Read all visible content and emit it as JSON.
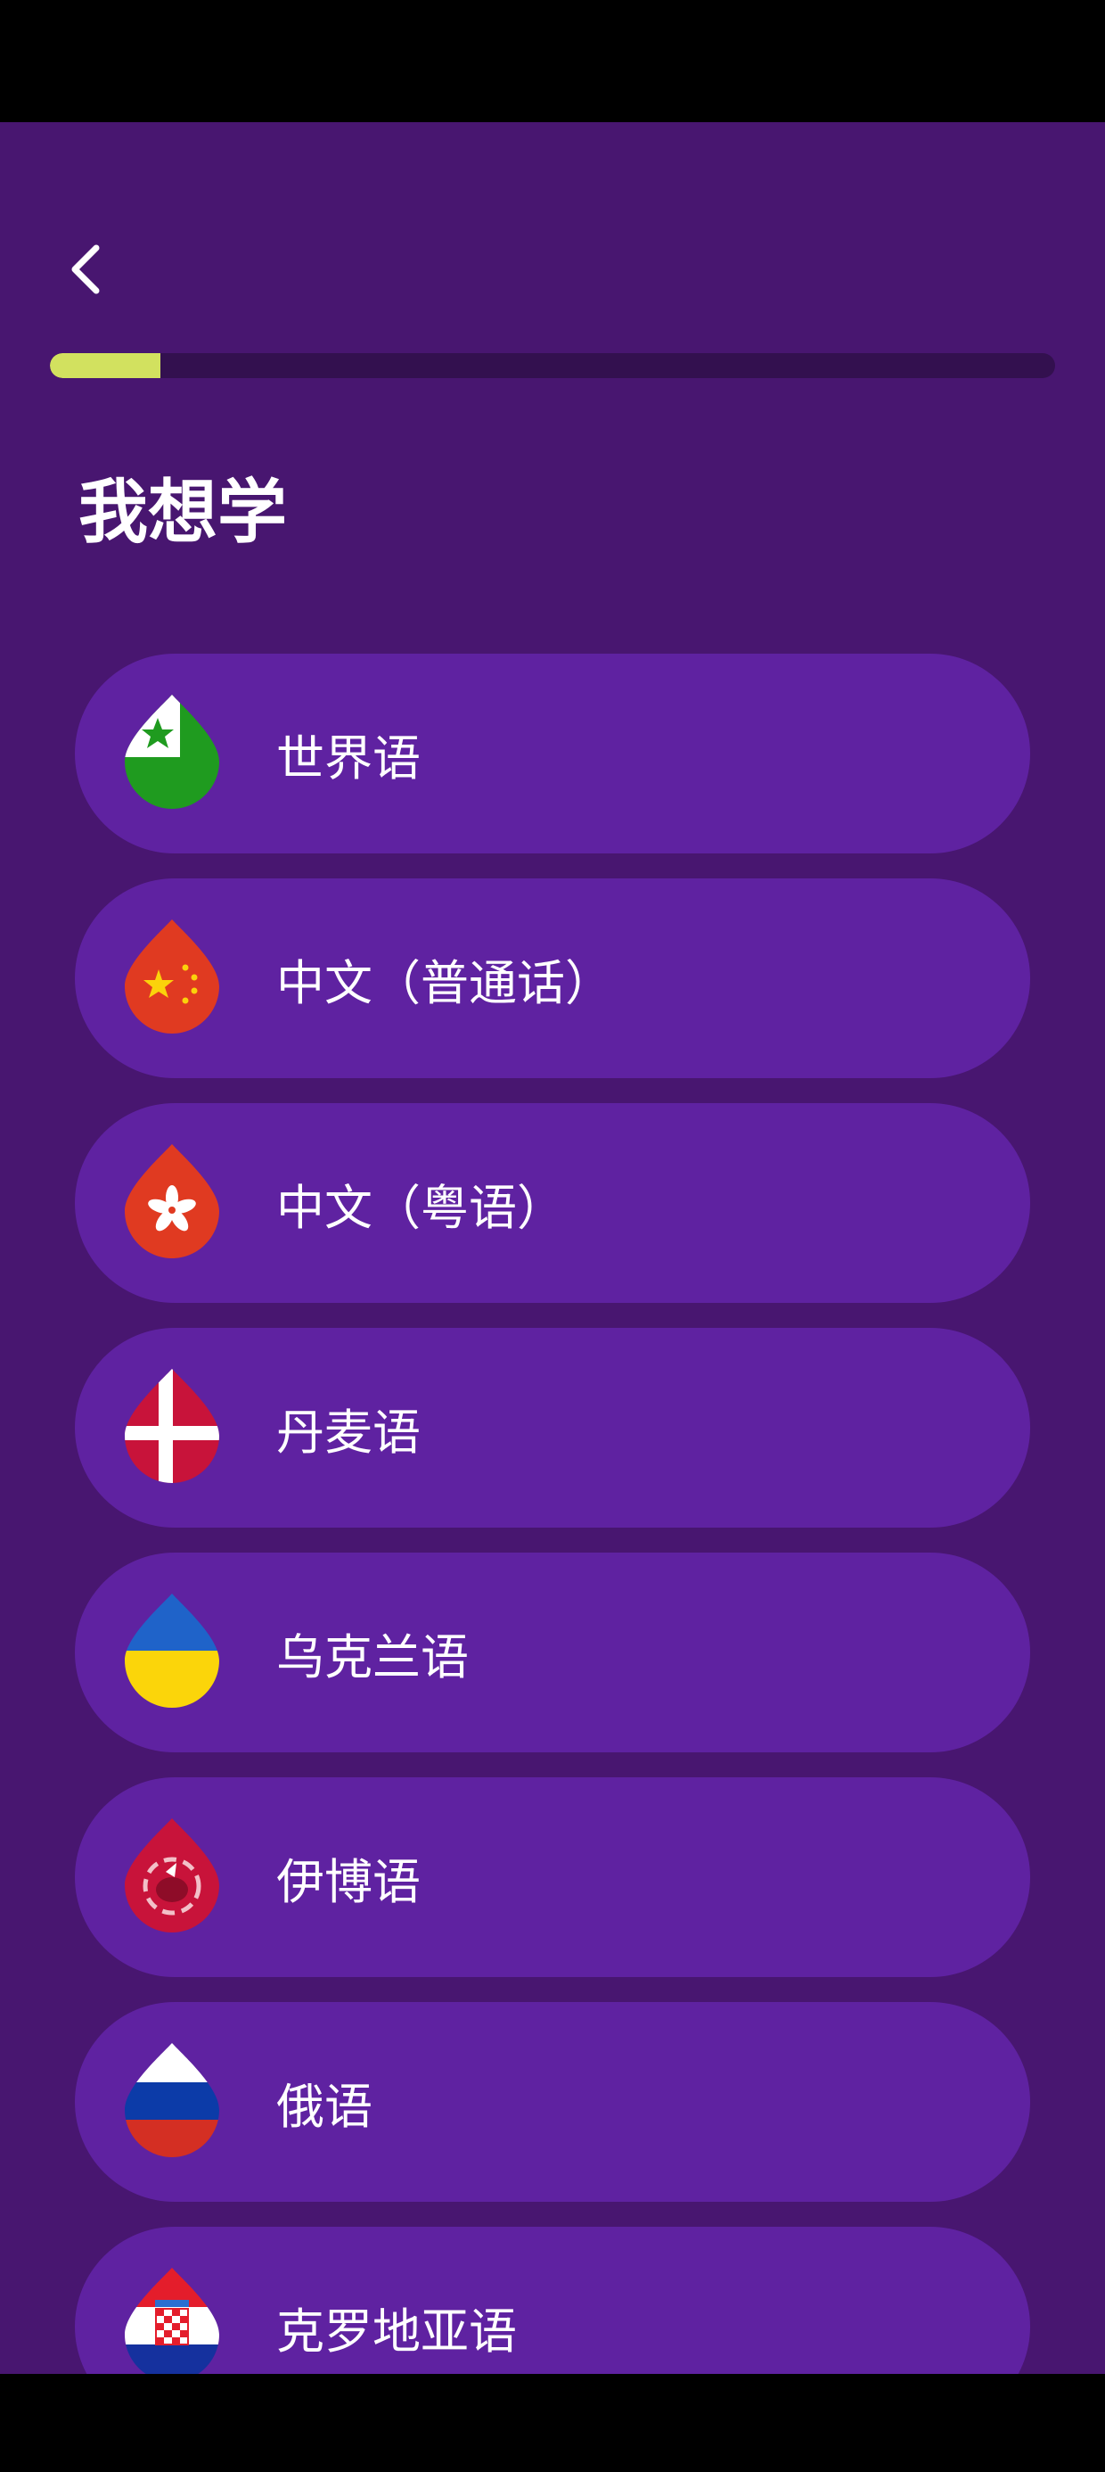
{
  "header": {
    "title": "我想学",
    "back_icon": "chevron-left-icon"
  },
  "progress": {
    "value_percent": 11,
    "fill_color": "#d2e15f",
    "track_color": "#33104f"
  },
  "theme": {
    "background": "#481670",
    "item_background": "#5f22a1",
    "text": "#ffffff"
  },
  "courses": [
    {
      "label": "世界语",
      "icon": "esperanto-flag-icon"
    },
    {
      "label": "中文（普通话）",
      "icon": "china-flag-icon"
    },
    {
      "label": "中文（粤语）",
      "icon": "hong-kong-flag-icon"
    },
    {
      "label": "丹麦语",
      "icon": "denmark-flag-icon"
    },
    {
      "label": "乌克兰语",
      "icon": "ukraine-flag-icon"
    },
    {
      "label": "伊博语",
      "icon": "igbo-flag-icon"
    },
    {
      "label": "俄语",
      "icon": "russia-flag-icon"
    },
    {
      "label": "克罗地亚语",
      "icon": "croatia-flag-icon"
    }
  ]
}
